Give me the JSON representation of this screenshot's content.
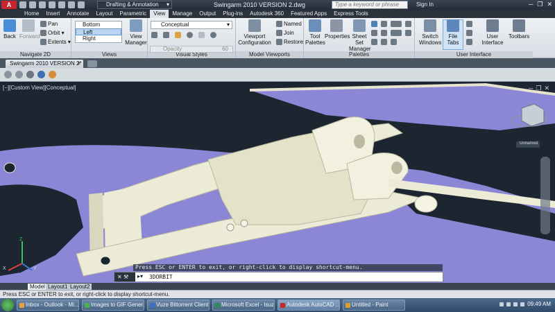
{
  "titlebar": {
    "app_button": "A",
    "workspace": "Drafting & Annotation",
    "title": "Swingarm 2010 VERSION 2.dwg",
    "search_placeholder": "Type a keyword or phrase",
    "sign_in": "Sign In"
  },
  "ribbon_tabs": [
    "Home",
    "Insert",
    "Annotate",
    "Layout",
    "Parametric",
    "View",
    "Manage",
    "Output",
    "Plug-ins",
    "Autodesk 360",
    "Featured Apps",
    "Express Tools"
  ],
  "active_tab": "View",
  "navigate": {
    "title": "Navigate 2D",
    "back": "Back",
    "forward": "Forward",
    "pan": "Pan",
    "orbit": "Orbit",
    "extents": "Extents"
  },
  "views": {
    "title": "Views",
    "items": [
      "Bottom",
      "Left",
      "Right"
    ],
    "selected": "Left",
    "view_manager": "View Manager"
  },
  "visual_styles": {
    "title": "Visual Styles",
    "current": "Conceptual",
    "opacity_label": "Opacity",
    "opacity_value": "60"
  },
  "model_viewports": {
    "title": "Model Viewports",
    "viewport_config": "Viewport Configuration",
    "named": "Named",
    "join": "Join",
    "restore": "Restore"
  },
  "palettes": {
    "title": "Palettes",
    "tool_palettes": "Tool Palettes",
    "properties": "Properties",
    "sheet_set_manager": "Sheet Set Manager"
  },
  "user_interface": {
    "title": "User Interface",
    "switch_windows": "Switch Windows",
    "file_tabs": "File Tabs",
    "user_interface": "User Interface",
    "toolbars": "Toolbars"
  },
  "file_tab": {
    "name": "Swingarm 2010 VERSION 2*",
    "close": "×"
  },
  "viewport": {
    "label": "[−][Custom View][Conceptual]",
    "viewcube_label": "Unnamed",
    "axis_z": "Z",
    "axis_y": "Y",
    "axis_x": "X"
  },
  "command": {
    "prompt": "Press ESC or ENTER to exit, or right-click to display shortcut-menu.",
    "value": "3DORBIT"
  },
  "layout_tabs": [
    "Model",
    "Layout1",
    "Layout2"
  ],
  "status_text": "Press ESC or ENTER to exit, or right-click to display shortcut-menu.",
  "taskbar": {
    "items": [
      {
        "label": "Inbox - Outlook - Mi...",
        "color": "#e6a23c"
      },
      {
        "label": "Images to GIF Gener...",
        "color": "#4caf50"
      },
      {
        "label": "Vuze Bittorrent Client",
        "color": "#3d6fc9"
      },
      {
        "label": "Microsoft Excel - Isuz...",
        "color": "#2e8b57"
      },
      {
        "label": "Autodesk AutoCAD ...",
        "color": "#c62828"
      },
      {
        "label": "Untitled - Paint",
        "color": "#d8a030"
      }
    ],
    "clock": "09:49 AM"
  },
  "colors": {
    "model_fill": "#8c86d6",
    "part_fill": "#ecebd6",
    "background": "#1c2630"
  }
}
